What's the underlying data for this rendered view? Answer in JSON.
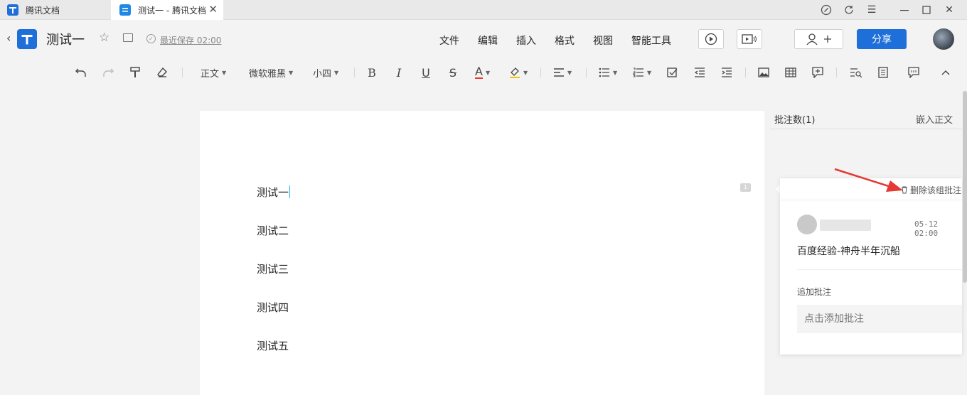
{
  "tabs": [
    {
      "label": "腾讯文档"
    },
    {
      "label": "测试一 - 腾讯文档"
    }
  ],
  "header": {
    "doc_title": "测试一",
    "save_status": "最近保存 02:00",
    "menus": [
      "文件",
      "编辑",
      "插入",
      "格式",
      "视图",
      "智能工具"
    ],
    "share_label": "分享",
    "accent": "#1e6fd9"
  },
  "toolbar": {
    "style": "正文",
    "font": "微软雅黑",
    "size": "小四",
    "bold": "B",
    "italic": "I",
    "underline": "U",
    "strike": "S",
    "font_color": "A"
  },
  "document": {
    "paragraphs": [
      "测试一",
      "测试二",
      "测试三",
      "测试四",
      "测试五"
    ]
  },
  "comments": {
    "count_label": "批注数(1)",
    "embed_label": "嵌入正文",
    "delete_label": "删除该组批注",
    "comment_marker": "1",
    "time": "05-12 02:00",
    "text": "百度经验-神舟半年沉船",
    "add_label": "追加批注",
    "input_placeholder": "点击添加批注"
  }
}
